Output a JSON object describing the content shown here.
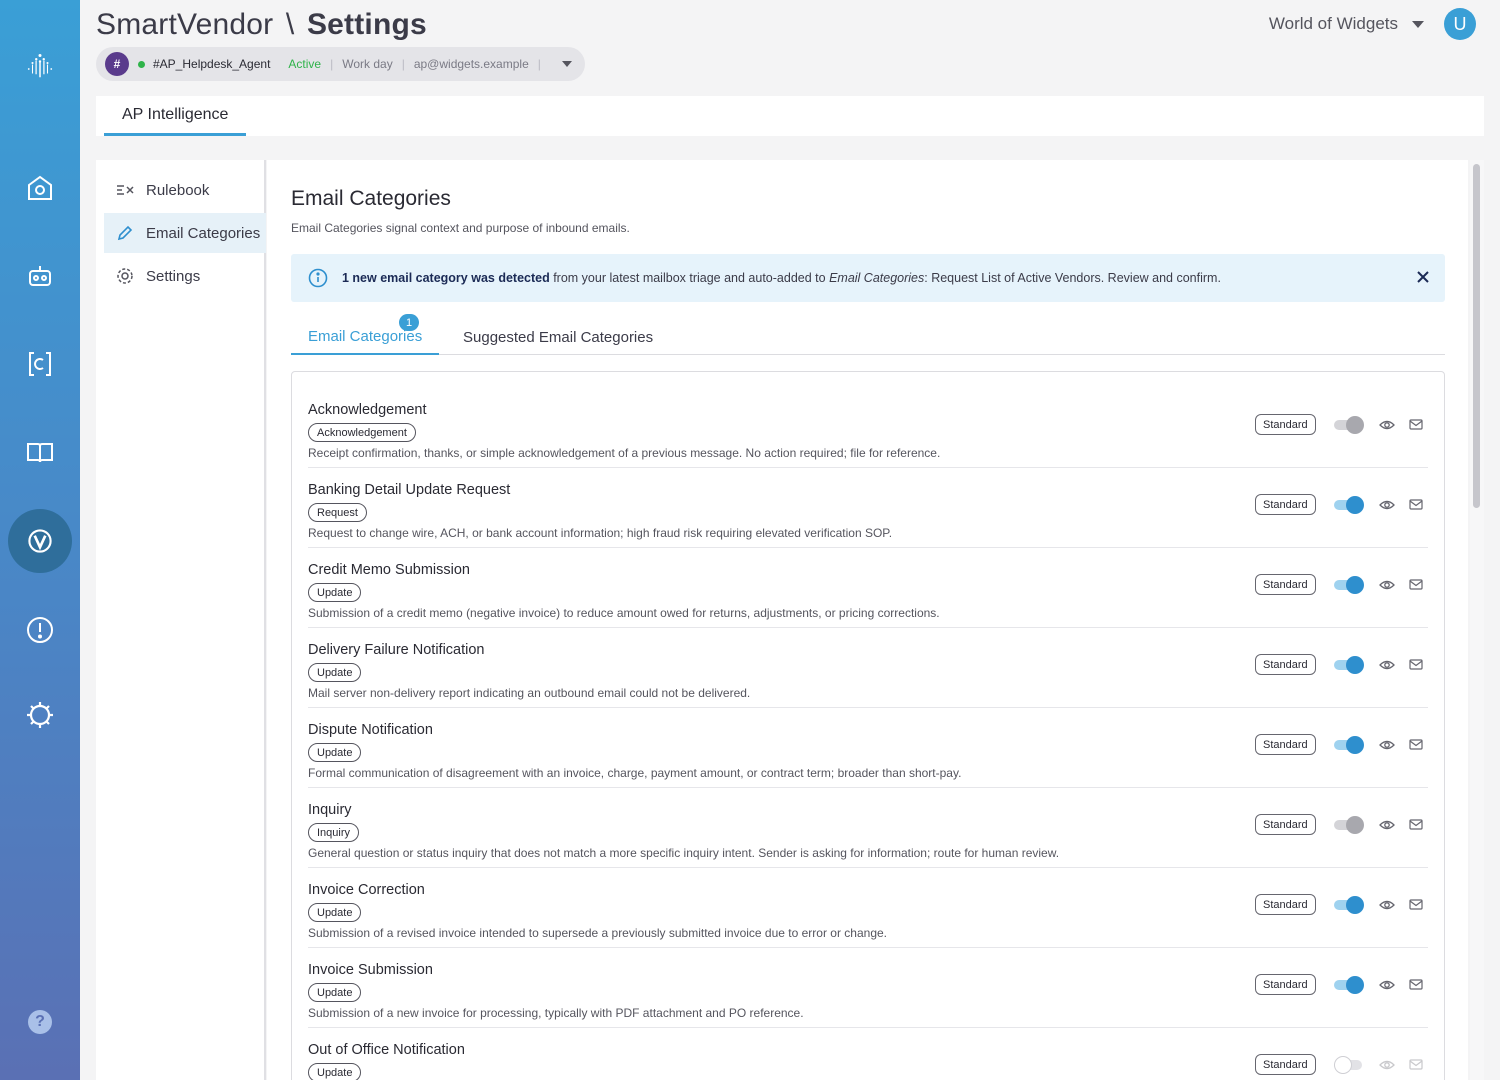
{
  "header": {
    "app_name": "SmartVendor",
    "separator": "\\",
    "page_title": "Settings",
    "org_name": "World of Widgets",
    "avatar_initial": "U"
  },
  "agent": {
    "hash": "#",
    "name": "#AP_Helpdesk_Agent",
    "status": "Active",
    "schedule": "Work day",
    "email": "ap@widgets.example",
    "status_color": "#2fb34a"
  },
  "rail": {
    "icons": [
      "logo-icon",
      "home-icon",
      "bot-icon",
      "code-icon",
      "book-icon",
      "vendor-icon",
      "alert-icon",
      "settings-gear-icon"
    ],
    "help_label": "?"
  },
  "top_tab": {
    "label": "AP Intelligence"
  },
  "settings_nav": {
    "items": [
      {
        "label": "Rulebook",
        "icon": "rulebook-icon"
      },
      {
        "label": "Email Categories",
        "icon": "pencil-icon",
        "active": true
      },
      {
        "label": "Settings",
        "icon": "gear-icon"
      }
    ]
  },
  "main": {
    "title": "Email Categories",
    "subtitle": "Email Categories signal context and purpose of inbound emails.",
    "banner": {
      "bold": "1 new email category was detected",
      "text1": " from your latest mailbox triage and auto-added to ",
      "italic": "Email Categories",
      "text2": ": Request List of Active Vendors. Review and confirm."
    },
    "tabs": [
      {
        "label": "Email Categories",
        "badge": "1"
      },
      {
        "label": "Suggested Email Categories"
      }
    ],
    "categories": [
      {
        "name": "Acknowledgement",
        "tag": "Acknowledgement",
        "description": "Receipt confirmation, thanks, or simple acknowledgement of a previous message. No action required; file for reference.",
        "badge": "Standard",
        "toggle": "grey"
      },
      {
        "name": "Banking Detail Update Request",
        "tag": "Request",
        "description": "Request to change wire, ACH, or bank account information; high fraud risk requiring elevated verification SOP.",
        "badge": "Standard",
        "toggle": "on"
      },
      {
        "name": "Credit Memo Submission",
        "tag": "Update",
        "description": "Submission of a credit memo (negative invoice) to reduce amount owed for returns, adjustments, or pricing corrections.",
        "badge": "Standard",
        "toggle": "on"
      },
      {
        "name": "Delivery Failure Notification",
        "tag": "Update",
        "description": "Mail server non-delivery report indicating an outbound email could not be delivered.",
        "badge": "Standard",
        "toggle": "on"
      },
      {
        "name": "Dispute Notification",
        "tag": "Update",
        "description": "Formal communication of disagreement with an invoice, charge, payment amount, or contract term; broader than short-pay.",
        "badge": "Standard",
        "toggle": "on"
      },
      {
        "name": "Inquiry",
        "tag": "Inquiry",
        "description": "General question or status inquiry that does not match a more specific inquiry intent. Sender is asking for information; route for human review.",
        "badge": "Standard",
        "toggle": "grey"
      },
      {
        "name": "Invoice Correction",
        "tag": "Update",
        "description": "Submission of a revised invoice intended to supersede a previously submitted invoice due to error or change.",
        "badge": "Standard",
        "toggle": "on"
      },
      {
        "name": "Invoice Submission",
        "tag": "Update",
        "description": "Submission of a new invoice for processing, typically with PDF attachment and PO reference.",
        "badge": "Standard",
        "toggle": "on"
      },
      {
        "name": "Out of Office Notification",
        "tag": "Update",
        "description": "",
        "badge": "Standard",
        "toggle": "off"
      }
    ]
  },
  "colors": {
    "accent": "#3a9fd6",
    "toggle_on": "#2e8fce",
    "banner_bg": "#e6f3fb"
  }
}
